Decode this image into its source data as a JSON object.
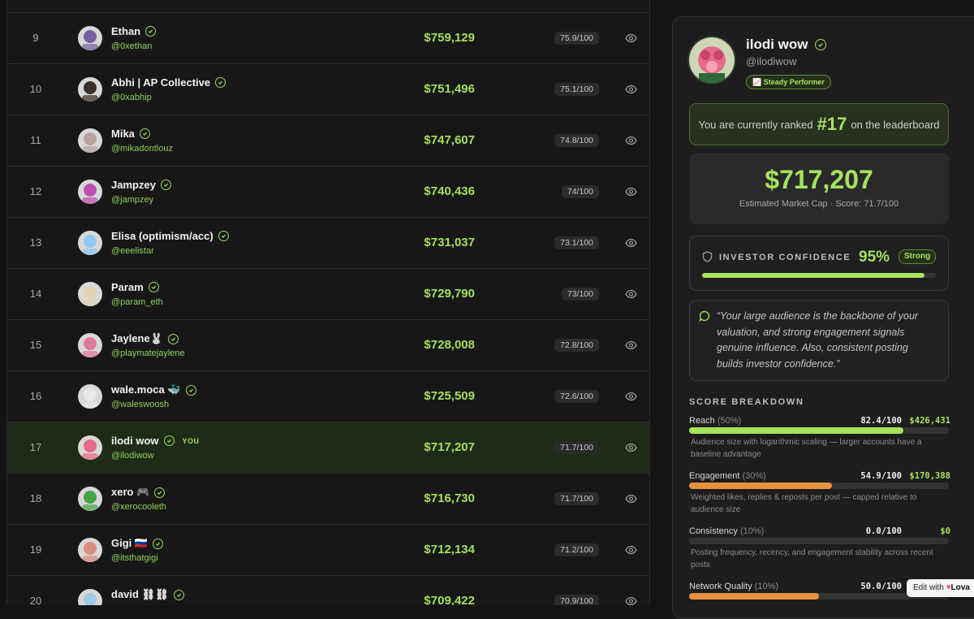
{
  "leaderboard": {
    "rows": [
      {
        "rank": "9",
        "name": "Ethan",
        "handle": "@0xethan",
        "value": "$759,129",
        "score": "75.9/100",
        "you": false,
        "avatar_color": "#7a5fa3"
      },
      {
        "rank": "10",
        "name": "Abhi | AP Collective",
        "handle": "@0xabhip",
        "value": "$751,496",
        "score": "75.1/100",
        "you": false,
        "avatar_color": "#3b2e28"
      },
      {
        "rank": "11",
        "name": "Mika",
        "handle": "@mikadontlouz",
        "value": "$747,607",
        "score": "74.8/100",
        "you": false,
        "avatar_color": "#b9a39a"
      },
      {
        "rank": "12",
        "name": "Jampzey",
        "handle": "@jampzey",
        "value": "$740,436",
        "score": "74/100",
        "you": false,
        "avatar_color": "#c14fb0"
      },
      {
        "rank": "13",
        "name": "Elisa (optimism/acc)",
        "handle": "@eeelistar",
        "value": "$731,037",
        "score": "73.1/100",
        "you": false,
        "avatar_color": "#8fc7f0"
      },
      {
        "rank": "14",
        "name": "Param",
        "handle": "@param_eth",
        "value": "$729,790",
        "score": "73/100",
        "you": false,
        "avatar_color": "#e4d2b0"
      },
      {
        "rank": "15",
        "name": "Jaylene🐰",
        "handle": "@playmatejaylene",
        "value": "$728,008",
        "score": "72.8/100",
        "you": false,
        "avatar_color": "#e07898"
      },
      {
        "rank": "16",
        "name": "wale.moca 🐳",
        "handle": "@waleswoosh",
        "value": "$725,509",
        "score": "72.6/100",
        "you": false,
        "avatar_color": "#e9e9e9"
      },
      {
        "rank": "17",
        "name": "ilodi wow",
        "handle": "@ilodiwow",
        "value": "$717,207",
        "score": "71.7/100",
        "you": true,
        "avatar_color": "#e86a8a"
      },
      {
        "rank": "18",
        "name": "xero 🎮",
        "handle": "@xerocooleth",
        "value": "$716,730",
        "score": "71.7/100",
        "you": false,
        "avatar_color": "#49a34b"
      },
      {
        "rank": "19",
        "name": "Gigi 🇷🇺",
        "handle": "@itsthatgigi",
        "value": "$712,134",
        "score": "71.2/100",
        "you": false,
        "avatar_color": "#d98e7e"
      },
      {
        "rank": "20",
        "name": "david ⛓⛓",
        "handle": "",
        "value": "$709,422",
        "score": "70.9/100",
        "you": false,
        "avatar_color": "#9fc9e6"
      }
    ],
    "you_label": "YOU"
  },
  "profile": {
    "name": "ilodi wow",
    "handle": "@ilodiwow",
    "badge": "📈 Steady Performer",
    "rank_prefix": "You are currently ranked",
    "rank": "#17",
    "rank_suffix": "on the leaderboard",
    "market_cap": "$717,207",
    "market_cap_sub": "Estimated Market Cap · Score: 71.7/100",
    "confidence_label": "INVESTOR CONFIDENCE",
    "confidence_pct": "95%",
    "confidence_value": 0.95,
    "confidence_tag": "Strong",
    "quote": "“Your large audience is the backbone of your valuation, and strong engagement signals genuine influence. Also, consistent posting builds investor confidence.”",
    "breakdown_title": "SCORE BREAKDOWN",
    "metrics": [
      {
        "name": "Reach",
        "weight": "(50%)",
        "score": "82.4/100",
        "value": "$426,431",
        "fill": 0.824,
        "color": "#a6e35f",
        "desc": "Audience size with logarithmic scaling — larger accounts have a baseline advantage"
      },
      {
        "name": "Engagement",
        "weight": "(30%)",
        "score": "54.9/100",
        "value": "$170,388",
        "fill": 0.549,
        "color": "#e8913f",
        "desc": "Weighted likes, replies & reposts per post — capped relative to audience size"
      },
      {
        "name": "Consistency",
        "weight": "(10%)",
        "score": "0.0/100",
        "value": "$0",
        "fill": 0.0,
        "color": "#a6e35f",
        "desc": "Posting frequency, recency, and engagement stability across recent posts"
      },
      {
        "name": "Network Quality",
        "weight": "(10%)",
        "score": "50.0/100",
        "value": "",
        "fill": 0.5,
        "color": "#e8913f",
        "desc": ""
      }
    ]
  },
  "lovable": {
    "prefix": "Edit with",
    "heart": "♥",
    "brand": "Lova"
  }
}
